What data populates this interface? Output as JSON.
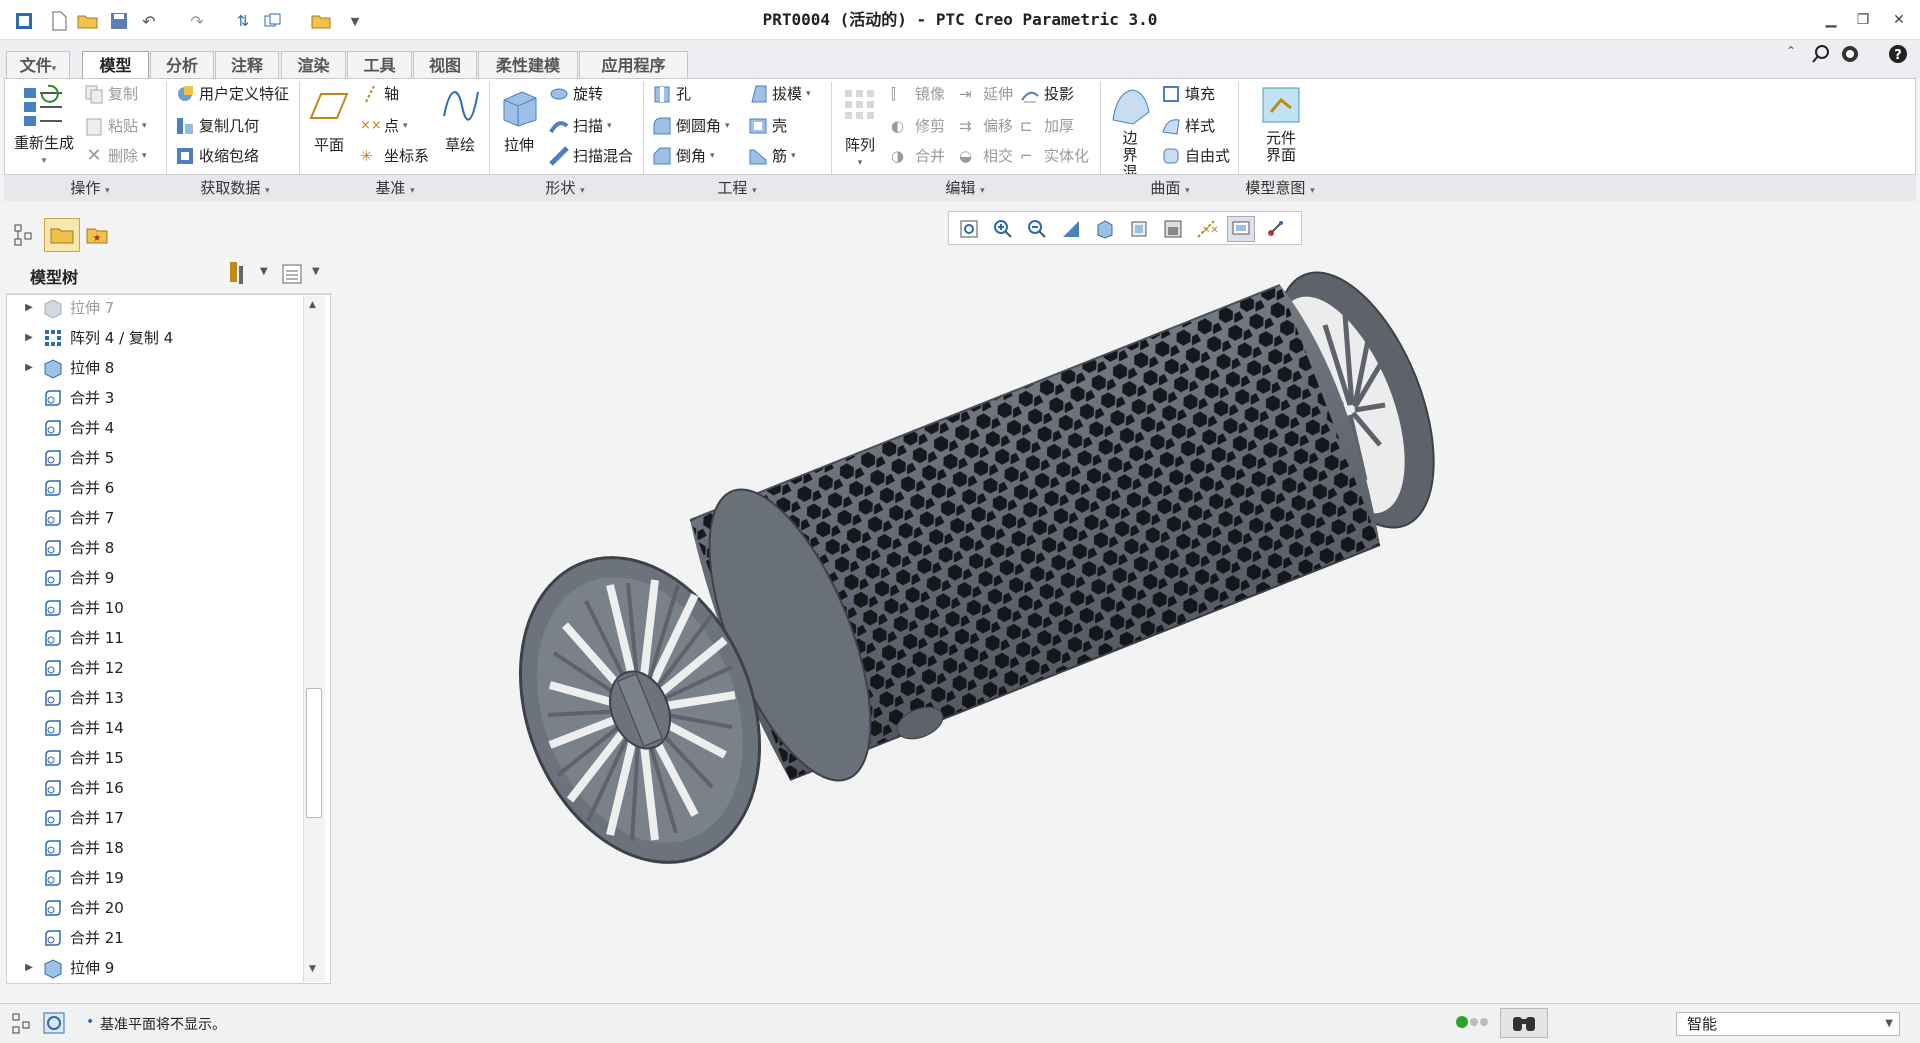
{
  "window": {
    "title": "PRT0004 (活动的) - PTC Creo Parametric 3.0"
  },
  "tabs": [
    {
      "label": "文件",
      "dropdown": "▾"
    },
    {
      "label": "模型"
    },
    {
      "label": "分析"
    },
    {
      "label": "注释"
    },
    {
      "label": "渲染"
    },
    {
      "label": "工具"
    },
    {
      "label": "视图"
    },
    {
      "label": "柔性建模"
    },
    {
      "label": "应用程序"
    }
  ],
  "ribbon": {
    "operations": {
      "regenerate": "重新生成",
      "copy": "复制",
      "paste": "粘贴",
      "delete": "删除",
      "group": "操作"
    },
    "get_data": {
      "udf": "用户定义特征",
      "copy_geom": "复制几何",
      "shrinkwrap": "收缩包络",
      "group": "获取数据"
    },
    "datum": {
      "plane": "平面",
      "axis": "轴",
      "point": "点",
      "csys": "坐标系",
      "sketch": "草绘",
      "group": "基准"
    },
    "shapes": {
      "extrude": "拉伸",
      "revolve": "旋转",
      "sweep": "扫描",
      "swept_blend": "扫描混合",
      "group": "形状"
    },
    "engineering": {
      "hole": "孔",
      "draft": "拔模",
      "round": "倒圆角",
      "shell": "壳",
      "chamfer": "倒角",
      "rib": "筋",
      "group": "工程"
    },
    "editing": {
      "pattern": "阵列",
      "mirror": "镜像",
      "extend": "延伸",
      "project": "投影",
      "trim": "修剪",
      "offset": "偏移",
      "thicken": "加厚",
      "merge": "合并",
      "intersect": "相交",
      "solidify": "实体化",
      "group": "编辑"
    },
    "surfaces": {
      "boundary_blend": "边界混合",
      "fill": "填充",
      "style": "样式",
      "freestyle": "自由式",
      "group": "曲面"
    },
    "model_intent": {
      "component_interface": "元件界面",
      "group": "模型意图"
    }
  },
  "model_tree": {
    "title": "模型树",
    "items": [
      {
        "label": "拉伸 7",
        "expandable": true,
        "dim": true
      },
      {
        "label": "阵列 4 / 复制 4",
        "expandable": true
      },
      {
        "label": "拉伸 8",
        "expandable": true
      },
      {
        "label": "合并 3"
      },
      {
        "label": "合并 4"
      },
      {
        "label": "合并 5"
      },
      {
        "label": "合并 6"
      },
      {
        "label": "合并 7"
      },
      {
        "label": "合并 8"
      },
      {
        "label": "合并 9"
      },
      {
        "label": "合并 10"
      },
      {
        "label": "合并 11"
      },
      {
        "label": "合并 12"
      },
      {
        "label": "合并 13"
      },
      {
        "label": "合并 14"
      },
      {
        "label": "合并 15"
      },
      {
        "label": "合并 16"
      },
      {
        "label": "合并 17"
      },
      {
        "label": "合并 18"
      },
      {
        "label": "合并 19"
      },
      {
        "label": "合并 20"
      },
      {
        "label": "合并 21"
      },
      {
        "label": "拉伸 9",
        "expandable": true
      }
    ]
  },
  "status": {
    "message": "基准平面将不显示。",
    "filter": "智能"
  },
  "colors": {
    "model": "#6d737d",
    "accent": "#2d6bb0"
  }
}
